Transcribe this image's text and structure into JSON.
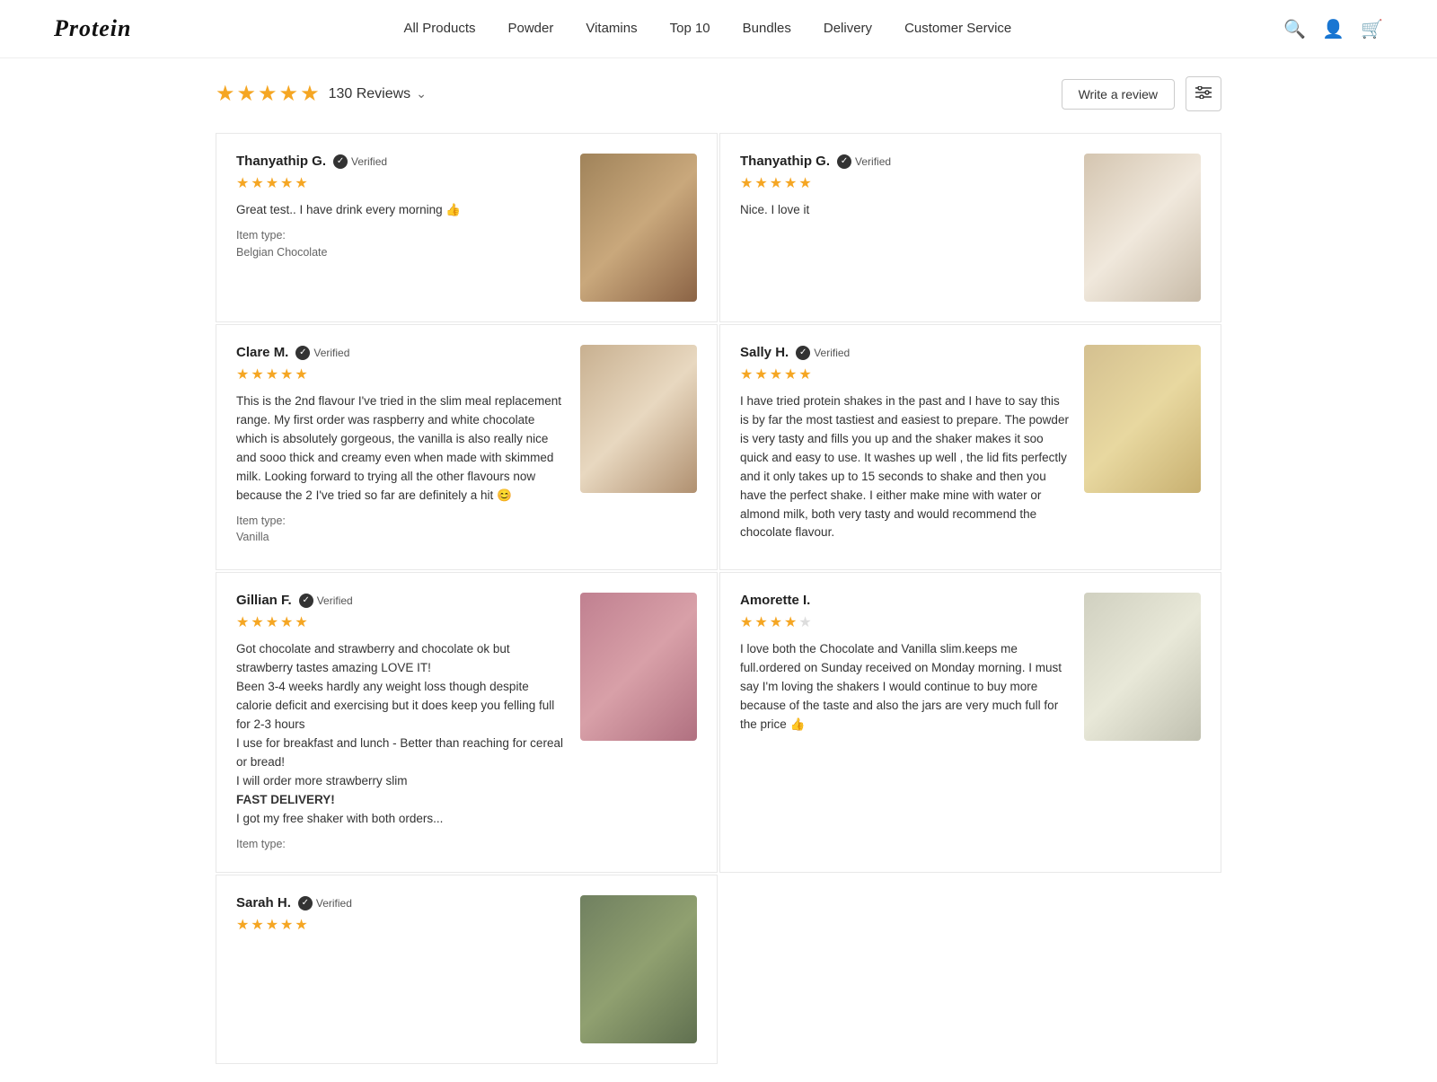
{
  "header": {
    "logo": "Protein",
    "nav": [
      {
        "label": "All Products",
        "id": "all-products"
      },
      {
        "label": "Powder",
        "id": "powder"
      },
      {
        "label": "Vitamins",
        "id": "vitamins"
      },
      {
        "label": "Top 10",
        "id": "top-10"
      },
      {
        "label": "Bundles",
        "id": "bundles"
      },
      {
        "label": "Delivery",
        "id": "delivery"
      },
      {
        "label": "Customer Service",
        "id": "customer-service"
      }
    ]
  },
  "reviews_summary": {
    "total_stars": 5,
    "filled_stars": 5,
    "count": "130 Reviews",
    "write_review_label": "Write a review",
    "filter_label": "≡"
  },
  "reviews": [
    {
      "id": 1,
      "name": "Thanyathip G.",
      "verified": true,
      "verified_label": "Verified",
      "stars": 5,
      "text": "Great test.. I have drink every morning 👍",
      "item_type_label": "Item type:",
      "item_type": "Belgian Chocolate",
      "has_image": true,
      "image_class": "img-brown"
    },
    {
      "id": 2,
      "name": "Thanyathip G.",
      "verified": true,
      "verified_label": "Verified",
      "stars": 5,
      "text": "Nice. I love it",
      "item_type_label": "",
      "item_type": "",
      "has_image": true,
      "image_class": "img-white-cup"
    },
    {
      "id": 3,
      "name": "Clare M.",
      "verified": true,
      "verified_label": "Verified",
      "stars": 5,
      "text": "This is the 2nd flavour I've tried in the slim meal replacement range. My first order was raspberry and white chocolate which is absolutely gorgeous, the vanilla is also really nice and sooo thick and creamy even when made with skimmed milk. Looking forward to trying all the other flavours now because the 2 I've tried so far are definitely a hit 😊",
      "item_type_label": "Item type:",
      "item_type": "Vanilla",
      "has_image": true,
      "image_class": "img-shaker-hand"
    },
    {
      "id": 4,
      "name": "Sally H.",
      "verified": true,
      "verified_label": "Verified",
      "stars": 5,
      "text": "I have tried protein shakes in the past and I have to say this is by far the most tastiest and easiest to prepare. The powder is very tasty and fills you up and the shaker makes it soo quick and easy to use. It washes up well , the lid fits perfectly and it only takes up to 15 seconds to shake and then you have the perfect shake. I either make mine with water or almond milk, both very tasty and would recommend the chocolate flavour.",
      "item_type_label": "",
      "item_type": "",
      "has_image": true,
      "image_class": "img-jars-shelf"
    },
    {
      "id": 5,
      "name": "Gillian F.",
      "verified": true,
      "verified_label": "Verified",
      "stars": 5,
      "text": "Got chocolate and strawberry and chocolate ok but strawberry tastes amazing LOVE IT!\nBeen 3-4 weeks hardly any weight loss though despite calorie deficit and exercising but it does keep you felling full for 2-3 hours\nI use for breakfast and lunch - Better than reaching for cereal or bread!\nI will order more strawberry slim\nFAST DELIVERY!\nI got my free shaker with both orders...",
      "item_type_label": "Item type:",
      "item_type": "",
      "has_image": true,
      "image_class": "img-pink-bottle"
    },
    {
      "id": 6,
      "name": "Amorette I.",
      "verified": false,
      "verified_label": "",
      "stars": 4,
      "text": "I love both the Chocolate and Vanilla slim.keeps me full.ordered on Sunday received on Monday morning. I must say I'm loving the shakers I would continue to buy more because of the taste and also the jars are very much full for the price 👍",
      "item_type_label": "",
      "item_type": "",
      "has_image": true,
      "image_class": "img-white-jars"
    },
    {
      "id": 7,
      "name": "Sarah H.",
      "verified": true,
      "verified_label": "Verified",
      "stars": 5,
      "text": "",
      "item_type_label": "",
      "item_type": "",
      "has_image": true,
      "image_class": "img-green-jar"
    }
  ]
}
